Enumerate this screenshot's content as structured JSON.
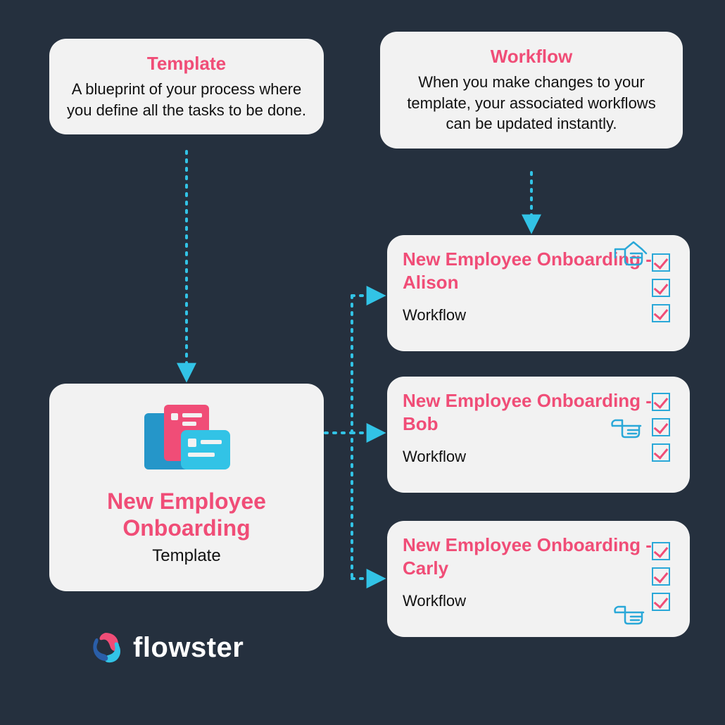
{
  "template_card": {
    "title": "Template",
    "desc": "A blueprint of your process where you define all the tasks to be done."
  },
  "workflow_card": {
    "title": "Workflow",
    "desc": "When you make changes to your template, your associated workflows can be updated instantly."
  },
  "template_main": {
    "title": "New Employee Onboarding",
    "subtitle": "Template"
  },
  "workflows": [
    {
      "title": "New Employee Onboarding - Alison",
      "subtitle": "Workflow"
    },
    {
      "title": "New Employee Onboarding - Bob",
      "subtitle": "Workflow"
    },
    {
      "title": "New Employee Onboarding - Carly",
      "subtitle": "Workflow"
    }
  ],
  "brand": {
    "name": "flowster"
  },
  "colors": {
    "bg": "#25303e",
    "card": "#f2f2f2",
    "accent_pink": "#f04d77",
    "accent_cyan": "#32c3e6",
    "accent_blue": "#2596c9"
  }
}
